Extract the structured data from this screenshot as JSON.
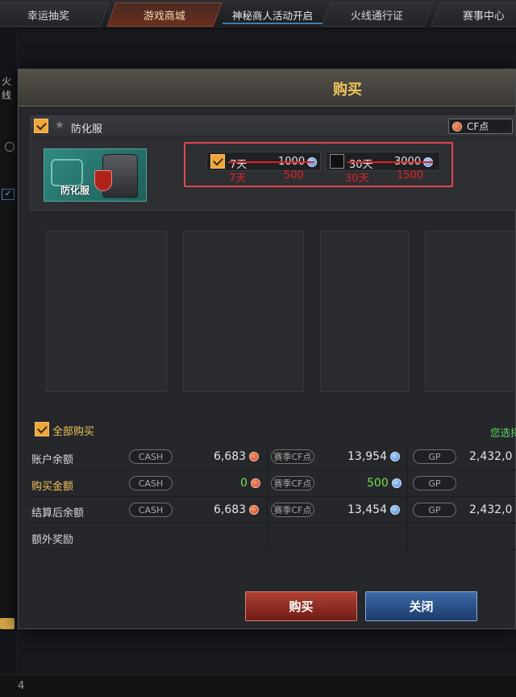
{
  "nav": {
    "tabs": [
      "幸运抽奖",
      "游戏商城",
      "神秘商人活动开启",
      "火线通行证",
      "赛事中心"
    ],
    "active_index": 1
  },
  "left_panel": {
    "fragment": "火线",
    "page_number": "4"
  },
  "dialog": {
    "title": "购买",
    "item": {
      "checked": true,
      "name": "防化服",
      "image_label": "防化服",
      "currency_tag": "CF点",
      "options": [
        {
          "checked": true,
          "duration": "7天",
          "price": "1000",
          "sale_duration": "7天",
          "sale_price": "500"
        },
        {
          "checked": false,
          "duration": "30天",
          "price": "3000",
          "sale_duration": "30天",
          "sale_price": "1500"
        }
      ]
    },
    "buy_all": {
      "checked": true,
      "label": "全部购买"
    },
    "selected_note": "您选择",
    "currency_labels": {
      "cash": "CASH",
      "cf": "赛季CF点",
      "gp": "GP"
    },
    "rows": [
      {
        "label": "账户余额",
        "cash": "6,683",
        "cf": "13,954",
        "gp": "2,432,0"
      },
      {
        "label": "购买金额",
        "cash": "0",
        "cf": "500",
        "gp": ""
      },
      {
        "label": "结算后余额",
        "cash": "6,683",
        "cf": "13,454",
        "gp": "2,432,0"
      },
      {
        "label": "额外奖励",
        "cash": "",
        "cf": "",
        "gp": ""
      }
    ],
    "buttons": {
      "buy": "购买",
      "close": "关闭"
    }
  },
  "colors": {
    "accent_gold": "#f0c65a",
    "highlight_red": "#e0474f",
    "value_green": "#74e04e"
  }
}
